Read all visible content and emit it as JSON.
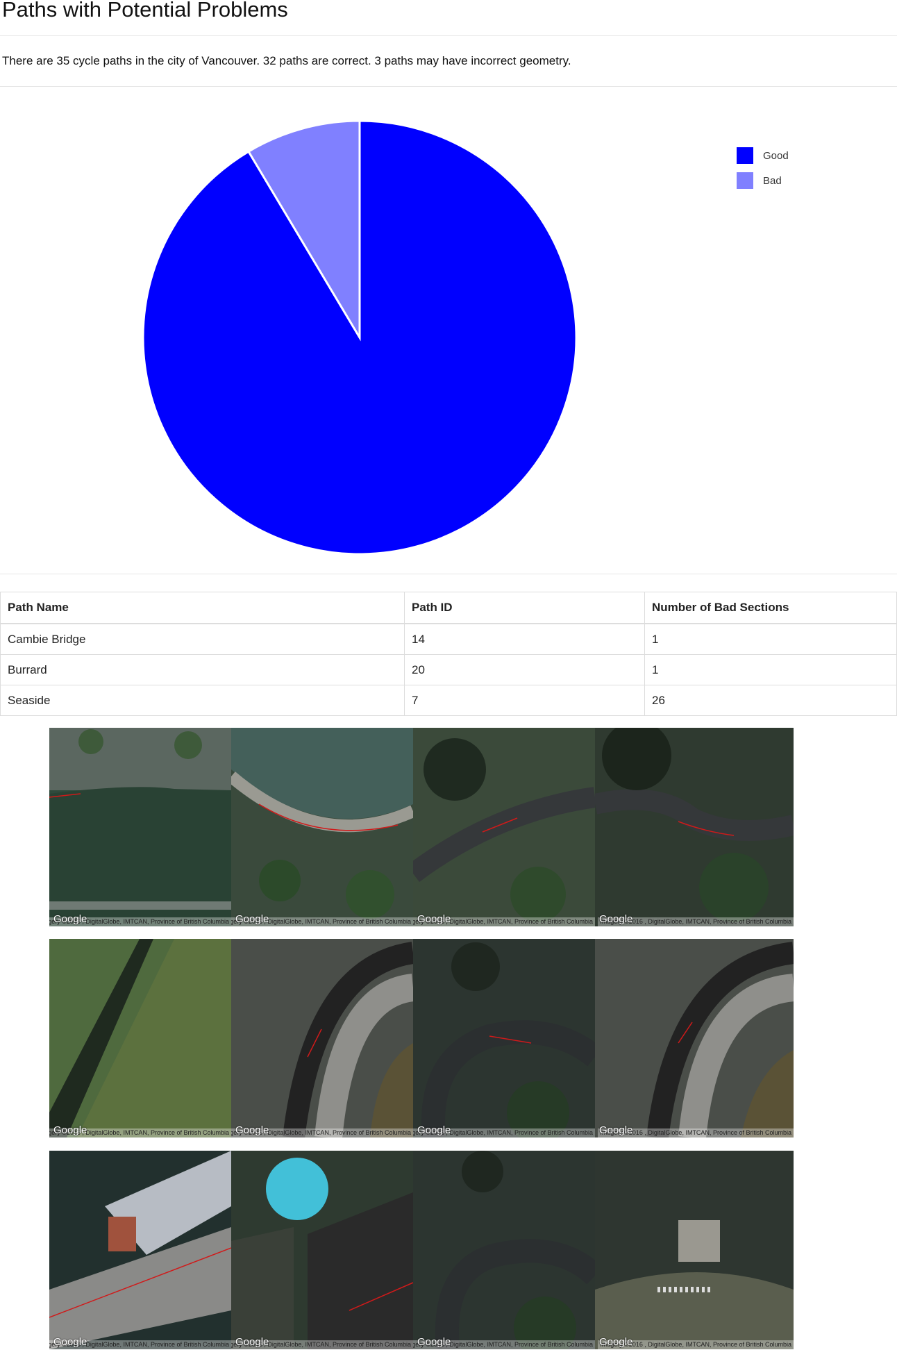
{
  "title": "Paths with Potential Problems",
  "summary": "There are 35 cycle paths in the city of Vancouver. 32 paths are correct. 3 paths may have incorrect geometry.",
  "chart_data": {
    "type": "pie",
    "categories": [
      "Good",
      "Bad"
    ],
    "values": [
      32,
      3
    ],
    "colors": [
      "#0000ff",
      "#8080ff"
    ],
    "legend": {
      "position": "right",
      "entries": [
        "Good",
        "Bad"
      ]
    }
  },
  "table": {
    "headers": [
      "Path Name",
      "Path ID",
      "Number of Bad Sections"
    ],
    "rows": [
      [
        "Cambie Bridge",
        "14",
        "1"
      ],
      [
        "Burrard",
        "20",
        "1"
      ],
      [
        "Seaside",
        "7",
        "26"
      ]
    ]
  },
  "map_tiles": {
    "logo": "Google",
    "attribution": "Imagery ©2016 , DigitalGlobe, IMTCAN, Province of British Columbia",
    "rows": [
      [
        "seawall-water",
        "seawall-curve",
        "forest-path",
        "forest-path-2"
      ],
      [
        "field-diagonal",
        "road-curve",
        "rocky-shore-path",
        "road-curve-2"
      ],
      [
        "bridge-truss",
        "pool-rooftop",
        "rocky-shore-path-2",
        "shore-building"
      ]
    ]
  }
}
